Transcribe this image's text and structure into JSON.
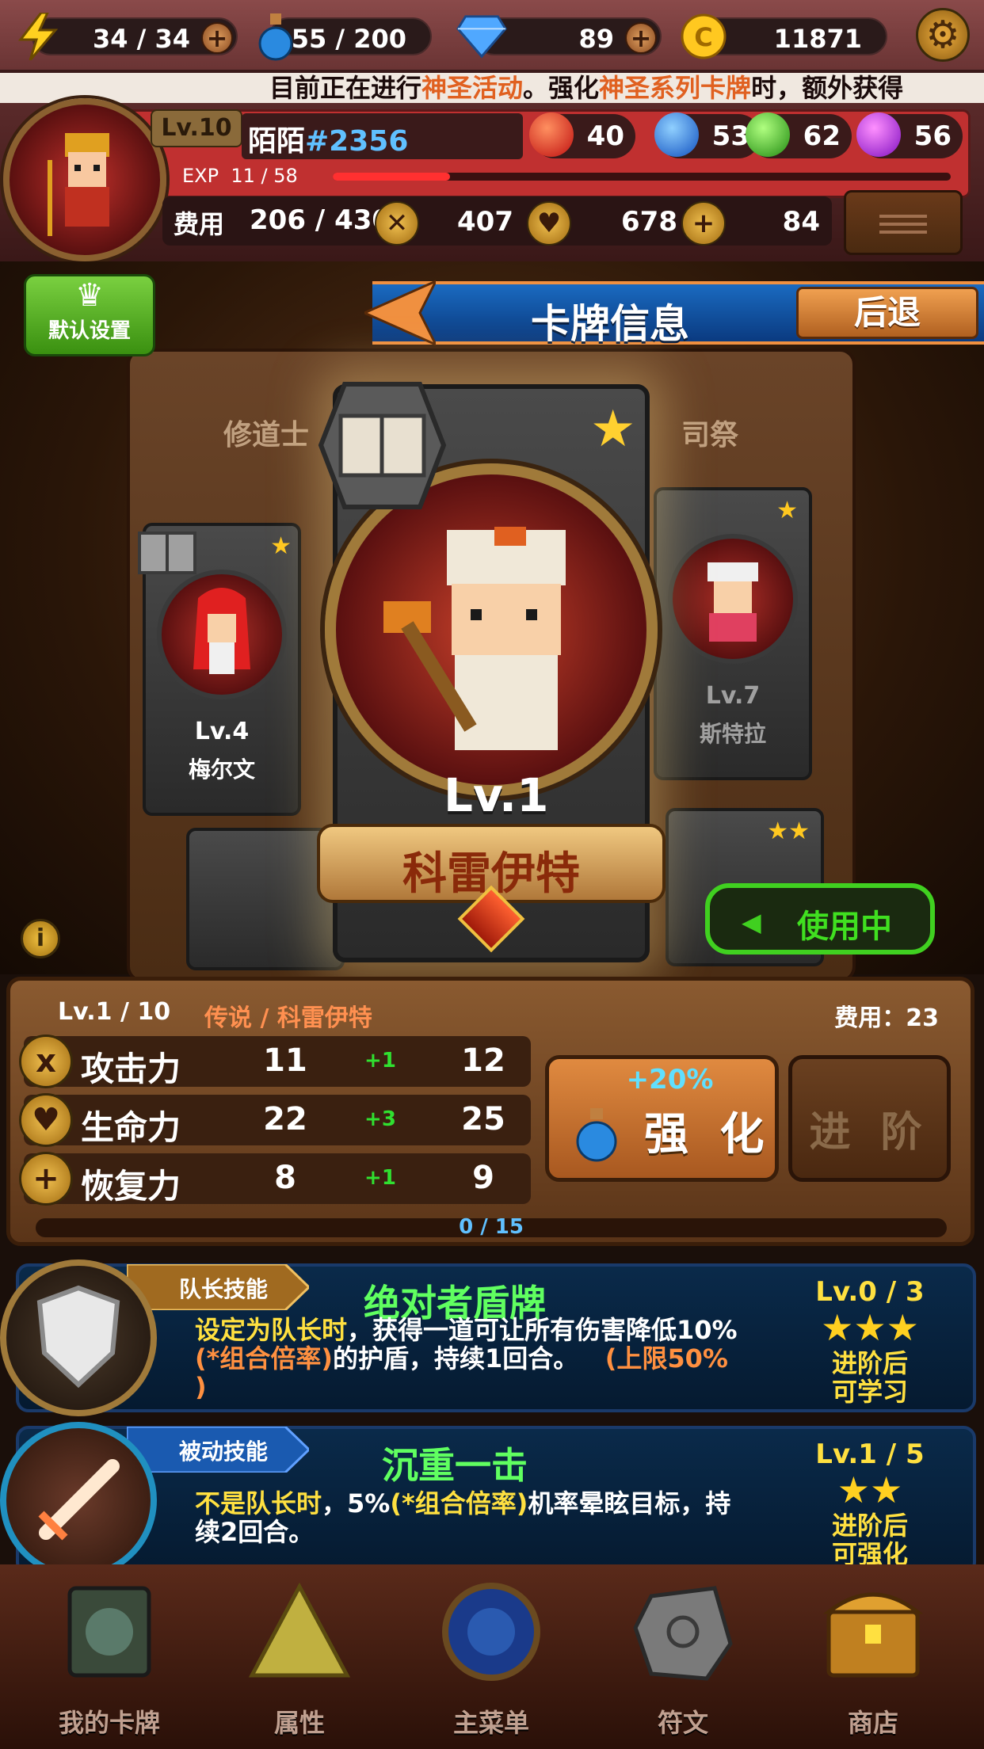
{
  "resources": {
    "energy": "34 / 34",
    "potion": "55 / 200",
    "diamond": "89",
    "gold": "11871"
  },
  "marquee": {
    "prefix": "目前正在进行",
    "event": "神圣活动",
    "middle": "。强化",
    "series": "神圣系列卡牌",
    "suffix": "时，额外获得"
  },
  "player": {
    "level": "Lv.10",
    "name": "陌陌",
    "tag": "#2356",
    "exp_label": "EXP",
    "exp_value": "11 / 58",
    "exp_fraction": 0.19,
    "orbs": {
      "fire": "40",
      "water": "53",
      "nature": "62",
      "dark": "56"
    },
    "cost_label": "费用",
    "cost": "206 / 430",
    "attack": "407",
    "hp": "678",
    "recovery": "84"
  },
  "nav": {
    "default_setting": "默认设置",
    "title": "卡牌信息",
    "back": "后退"
  },
  "carousel": {
    "left_group": "修道士",
    "right_group": "司祭",
    "left_card": {
      "level": "Lv.4",
      "name": "梅尔文"
    },
    "right_card": {
      "level": "Lv.7",
      "name": "斯特拉"
    }
  },
  "card": {
    "level": "Lv.1",
    "name": "科雷伊特",
    "status": "使用中",
    "info_icon": "i"
  },
  "detail": {
    "level": "Lv.1 / 10",
    "rarity": "传说 / 科雷伊特",
    "cost": "费用：23",
    "stats": [
      {
        "name": "攻击力",
        "icon": "x",
        "current": "11",
        "inc": "+1",
        "next": "12"
      },
      {
        "name": "生命力",
        "icon": "♥",
        "current": "22",
        "inc": "+3",
        "next": "25"
      },
      {
        "name": "恢复力",
        "icon": "+",
        "current": "8",
        "inc": "+1",
        "next": "9"
      }
    ],
    "enhance_bonus": "+20%",
    "enhance": "强 化",
    "advance": "进 阶",
    "progress": "0 / 15"
  },
  "skills": {
    "leader": {
      "tab": "队长技能",
      "name": "绝对者盾牌",
      "level": "Lv.0 / 3",
      "stars": "★★★",
      "desc_a": "设定为队长时",
      "desc_b": "，获得一道可让所有伤害降低10%",
      "desc_c": "(*组合倍率)",
      "desc_d": "的护盾，持续1回合。",
      "desc_e": "(上限50%",
      "desc_f": ")",
      "note_1": "进阶后",
      "note_2": "可学习"
    },
    "passive": {
      "tab": "被动技能",
      "name": "沉重一击",
      "level": "Lv.1 / 5",
      "stars": "★★",
      "desc_a": "不是队长时",
      "desc_b": "，5%",
      "desc_c": "(*组合倍率)",
      "desc_d": "机率晕眩目标，持",
      "desc_e": "续2回合。",
      "note_1": "进阶后",
      "note_2": "可强化"
    }
  },
  "bottom_nav": [
    {
      "label": "我的卡牌"
    },
    {
      "label": "属性"
    },
    {
      "label": "主菜单"
    },
    {
      "label": "符文"
    },
    {
      "label": "商店"
    }
  ]
}
